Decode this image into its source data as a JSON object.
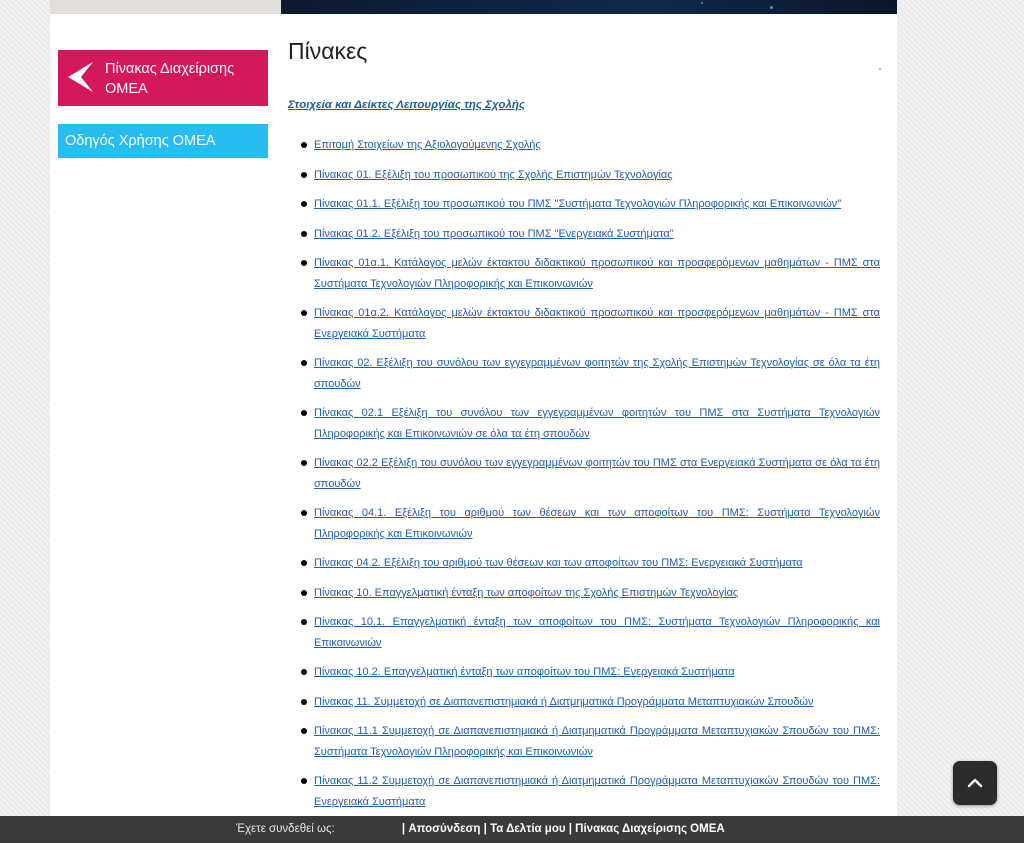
{
  "sidebar": {
    "main_label": "Πίνακας Διαχείρισης ΟΜΕΑ",
    "guide_label": "Οδηγός Χρήσης ΟΜΕΑ",
    "main_color": "#d4185e",
    "guide_color": "#27bdf0",
    "main_icon": "paper-plane-icon"
  },
  "main": {
    "title": "Πίνακες",
    "section_heading": "Στοιχεία και Δείκτες Λειτουργίας της Σχολής",
    "links": [
      "Επιτομή Στοιχείων της Αξιολογούμενης Σχολής",
      "Πίνακας 01. Εξέλιξη του προσωπικού της Σχολής Επιστημών Τεχνολογίας",
      "Πίνακας 01.1. Εξέλιξη του προσωπικού του ΠΜΣ \"Συστήματα Τεχνολογιών Πληροφορικής και Επικοινωνιών\"",
      "Πίνακας 01.2. Εξέλιξη του προσωπικού του ΠΜΣ \"Ενεργειακά Συστήματα\"",
      "Πίνακας 01α.1. Κατάλογος μελών έκτακτου διδακτικού προσωπικού και προσφερόμενων μαθημάτων - ΠΜΣ στα Συστήματα Τεχνολογιών Πληροφορικής και Επικοινωνιών",
      "Πίνακας 01α.2. Κατάλογος μελών έκτακτου διδακτικού προσωπικού και προσφερόμενων μαθημάτων - ΠΜΣ στα Ενεργειακά Συστήματα",
      "Πίνακας 02. Εξέλιξη του συνόλου των εγγεγραμμένων φοιτητών της Σχολής Επιστημών Τεχνολογίας σε όλα τα έτη σπουδών",
      "Πίνακας 02.1 Εξέλιξη του συνόλου των εγγεγραμμένων φοιτητών του ΠΜΣ στα Συστήματα Τεχνολογιών Πληροφορικής και Επικοινωνιών σε όλα τα έτη σπουδών",
      "Πίνακας 02.2 Εξέλιξη του συνόλου των εγγεγραμμένων φοιτητών του ΠΜΣ στα Ενεργειακά Συστήματα σε όλα τα έτη σπουδών",
      "Πίνακας 04.1. Εξέλιξη του αριθμού των θέσεων και των αποφοίτων του ΠΜΣ: Συστήματα Τεχνολογιών Πληροφορικής και Επικοινωνιών",
      "Πίνακας 04.2. Εξέλιξη του αριθμού των θέσεων και των αποφοίτων του ΠΜΣ: Ενεργειακά Συστήματα",
      "Πίνακας 10. Επαγγελματική ένταξη των αποφοίτων της Σχολής Επιστημών Τεχνολογίας",
      "Πίνακας 10.1. Επαγγελματική ένταξη των αποφοίτων του ΠΜΣ: Συστήματα Τεχνολογιών Πληροφορικής και Επικοινωνιών",
      "Πίνακας 10.2. Επαγγελματική ένταξη των αποφοίτων του ΠΜΣ: Ενεργειακά Συστήματα",
      "Πίνακας 11. Συμμετοχή σε Διαπανεπιστημιακά ή Διατμηματικά Προγράμματα Μεταπτυχιακών Σπουδών",
      "Πίνακας 11.1 Συμμετοχή σε Διαπανεπιστημιακά ή Διατμηματικά Προγράμματα Μεταπτυχιακών Σπουδών του ΠΜΣ: Συστήματα Τεχνολογιών Πληροφορικής και Επικοινωνιών",
      "Πίνακας 11.2 Συμμετοχή σε Διαπανεπιστημιακά ή Διατμηματικά Προγράμματα Μεταπτυχιακών Σπουδών του ΠΜΣ: Ενεργειακά Συστήματα"
    ]
  },
  "footer": {
    "logged_in_label": "Έχετε συνδεθεί ως:",
    "separator": "|",
    "logout": "Αποσύνδεση",
    "my_tickets": "Τα Δελτία μου",
    "admin_panel": "Πίνακας Διαχείρισης ΟΜΕΑ"
  },
  "scroll_top_icon": "chevron-up-icon"
}
